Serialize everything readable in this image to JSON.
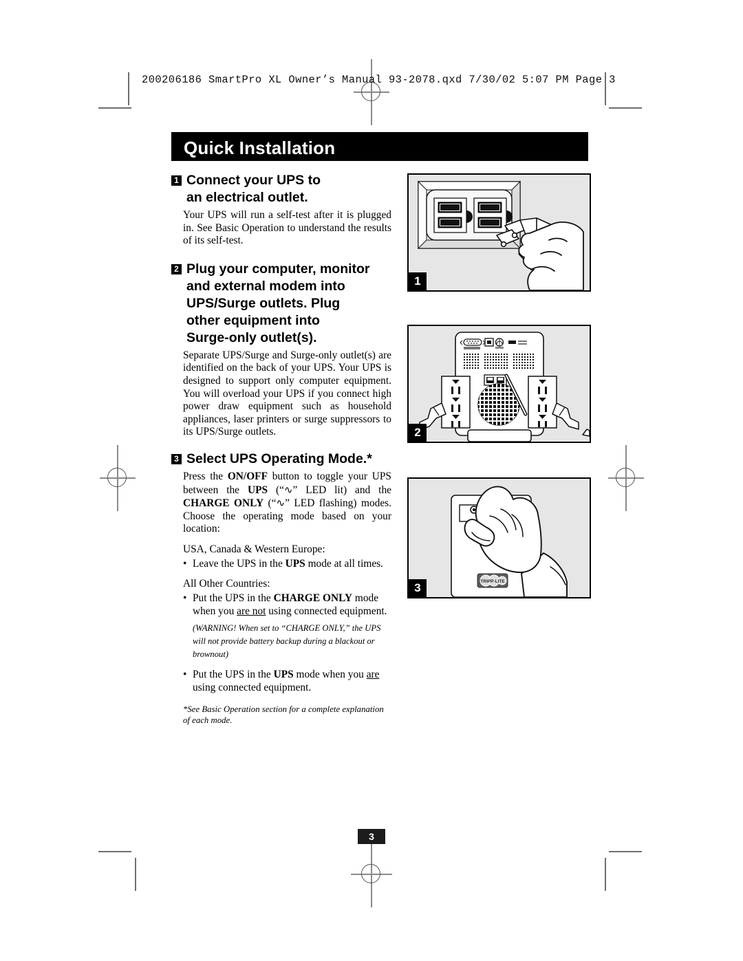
{
  "file_header": "200206186 SmartPro XL Owner’s Manual 93-2078.qxd  7/30/02  5:07 PM  Page 3",
  "title": "Quick Installation",
  "page_number": "3",
  "steps": [
    {
      "number": "1",
      "heading_line1": "Connect your UPS to",
      "heading_line2": "an electrical outlet.",
      "body": "Your UPS will run a self-test after it is plugged in. See Basic Operation to understand the results of its self-test."
    },
    {
      "number": "2",
      "heading_line1": "Plug your computer, monitor",
      "heading_line2": "and external modem into",
      "heading_line3": "UPS/Surge outlets. Plug",
      "heading_line4": "other equipment into",
      "heading_line5": "Surge-only outlet(s).",
      "body": "Separate UPS/Surge and Surge-only outlet(s) are identified on the back of your UPS. Your UPS is designed to support only computer equipment. You will overload your UPS if you connect high power draw equipment such as household appliances, laser printers or surge suppressors to its UPS/Surge outlets."
    },
    {
      "number": "3",
      "heading_line1": "Select UPS Operating Mode.*",
      "body_part1": "Press the ",
      "body_onoff": "ON/OFF",
      "body_part2": " button to toggle your UPS between the ",
      "body_ups": "UPS",
      "body_part3": " (“",
      "body_sine1": "∿",
      "body_part4": "” LED lit) and the ",
      "body_charge": "CHARGE ONLY",
      "body_part5": " (“",
      "body_sine2": "∿",
      "body_part6": "” LED flashing) modes. Choose the operating mode based on your location:",
      "region1_label": "USA, Canada & Western Europe:",
      "region1_bullet_pre": "Leave the UPS in the ",
      "region1_bullet_bold": "UPS",
      "region1_bullet_post": " mode at all times.",
      "region2_label": "All Other Countries:",
      "region2_bullet_pre": "Put the UPS in the ",
      "region2_bullet_bold": "CHARGE ONLY",
      "region2_bullet_mid": " mode when you ",
      "region2_bullet_underline": "are not",
      "region2_bullet_post": " using connected equipment.",
      "warning": "(WARNING! When set to “CHARGE ONLY,” the UPS will not provide battery backup during a blackout or brownout)",
      "region3_bullet_pre": "Put the UPS in the ",
      "region3_bullet_bold": "UPS",
      "region3_bullet_mid": " mode when you ",
      "region3_bullet_underline": "are",
      "region3_bullet_post": " using connected equipment.",
      "footnote": "*See Basic Operation section for a complete explanation of  each mode."
    }
  ],
  "figures": [
    {
      "badge": "1",
      "caption_semantic": "hand plugging power cord into wall electrical outlet"
    },
    {
      "badge": "2",
      "caption_semantic": "rear panel of UPS showing UPS/Surge and Surge-only outlet banks, serial port, vent grille and power cords"
    },
    {
      "badge": "3",
      "caption_semantic": "hand pressing the ON/OFF button on the UPS front panel with Tripp Lite logo"
    }
  ],
  "figure3_logo_text": "TRIPP·LITE",
  "colors": {
    "banner_bg": "#000000",
    "banner_text": "#ffffff",
    "figure_bg": "#e6e6e6",
    "figure_border": "#000000",
    "crop_mark": "#6e6e6e"
  }
}
